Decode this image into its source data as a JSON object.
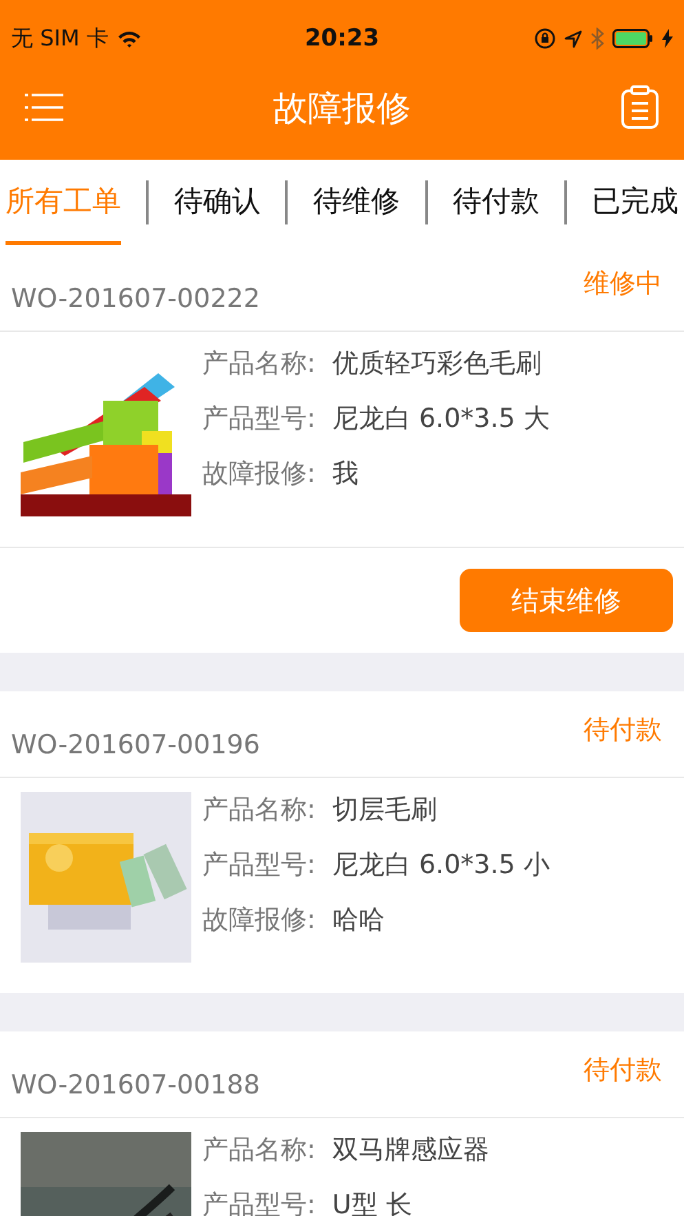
{
  "status_bar": {
    "carrier": "无 SIM 卡",
    "time": "20:23"
  },
  "nav": {
    "title": "故障报修"
  },
  "tabs": [
    {
      "label": "所有工单",
      "selected": true
    },
    {
      "label": "待确认",
      "selected": false
    },
    {
      "label": "待维修",
      "selected": false
    },
    {
      "label": "待付款",
      "selected": false
    },
    {
      "label": "已完成",
      "selected": false
    }
  ],
  "orders": [
    {
      "order_no": "WO-201607-00222",
      "status": "维修中",
      "image": {
        "kind": "picture"
      },
      "fields": [
        {
          "label": "产品名称:",
          "value": "优质轻巧彩色毛刷"
        },
        {
          "label": "产品型号:",
          "value": "尼龙白 6.0*3.5 大"
        },
        {
          "label": "故障报修:",
          "value": "我"
        }
      ],
      "action": "结束维修"
    },
    {
      "order_no": "WO-201607-00196",
      "status": "待付款",
      "image": {
        "kind": "picture"
      },
      "fields": [
        {
          "label": "产品名称:",
          "value": "切层毛刷"
        },
        {
          "label": "产品型号:",
          "value": "尼龙白 6.0*3.5 小"
        },
        {
          "label": "故障报修:",
          "value": "哈哈"
        }
      ]
    },
    {
      "order_no": "WO-201607-00188",
      "status": "待付款",
      "image": {
        "kind": "picture"
      },
      "fields": [
        {
          "label": "产品名称:",
          "value": "双马牌感应器"
        },
        {
          "label": "产品型号:",
          "value": "U型 长"
        }
      ]
    }
  ]
}
